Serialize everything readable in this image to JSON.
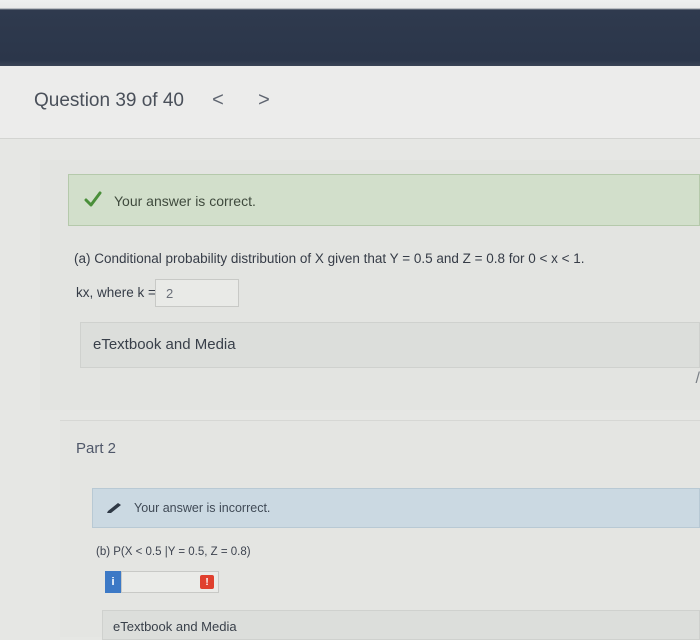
{
  "header": {
    "question_label": "Question 39 of 40",
    "prev_glyph": "<",
    "next_glyph": ">"
  },
  "part_a": {
    "feedback": "Your answer is correct.",
    "prompt": "(a) Conditional probability distribution of X given that Y = 0.5 and Z = 0.8 for 0 < x < 1.",
    "answer_prefix": "kx, where k =",
    "k_value": "2",
    "etextbook_label": "eTextbook and Media"
  },
  "part_2": {
    "title": "Part 2",
    "feedback": "Your answer is incorrect.",
    "prompt": "(b) P(X < 0.5 |Y = 0.5, Z = 0.8)",
    "info_glyph": "i",
    "warning_glyph": "!",
    "etextbook_label": "eTextbook and Media"
  },
  "colors": {
    "correct_banner": "#d2dfcb",
    "incorrect_banner": "#cbd9e2",
    "info_button": "#3c79c6",
    "warning_icon": "#e0402e",
    "check_icon": "#4a8f3a"
  },
  "icons": {
    "correct": "check-icon",
    "incorrect": "pencil-icon",
    "info": "info-icon",
    "warning": "warning-icon",
    "prev": "chevron-left-icon",
    "next": "chevron-right-icon"
  }
}
